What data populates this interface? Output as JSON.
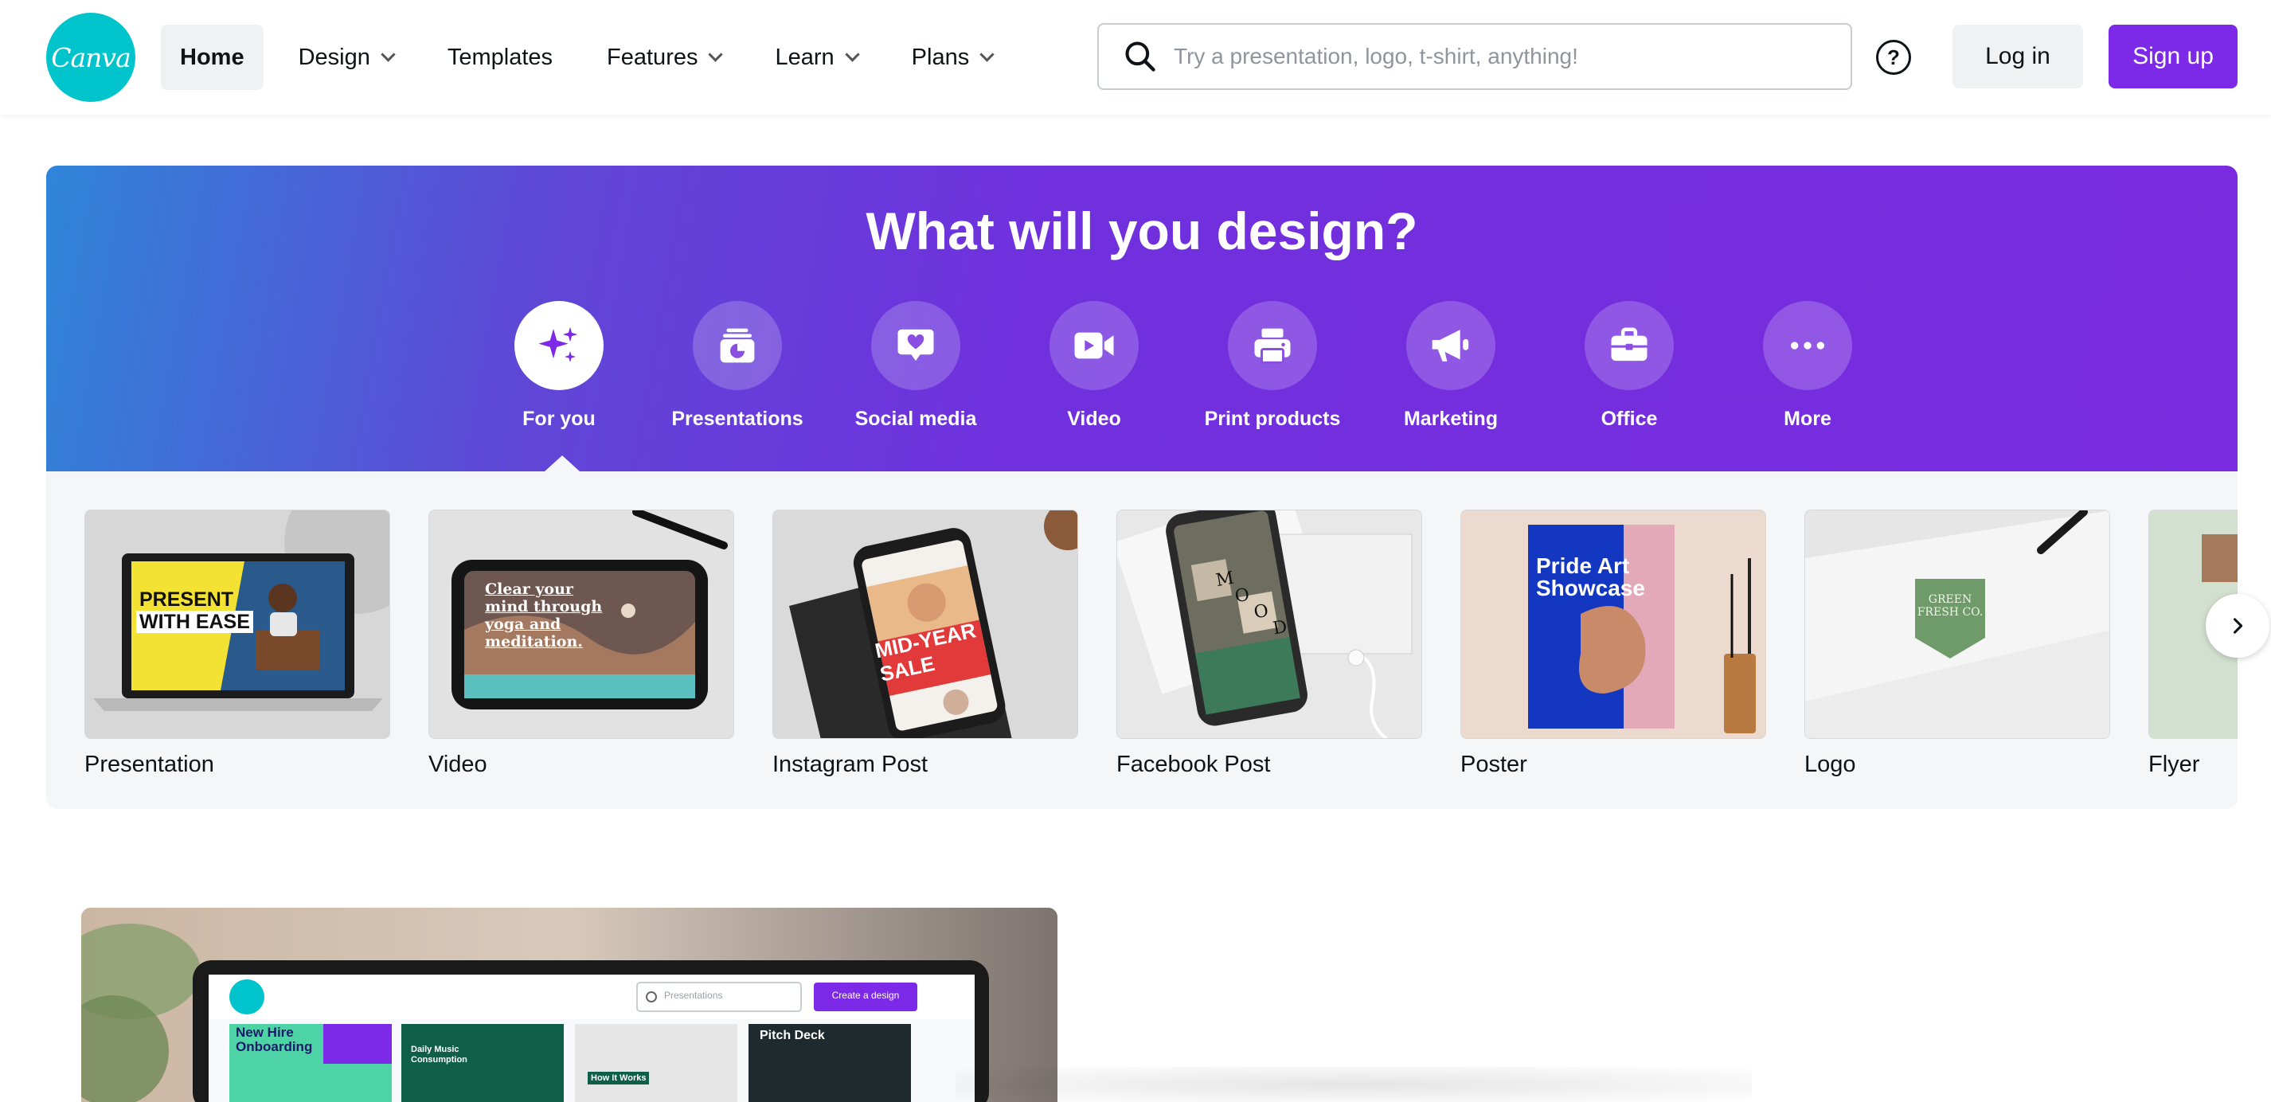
{
  "header": {
    "logo_text": "Canva",
    "nav": [
      {
        "label": "Home",
        "dropdown": false,
        "active": true
      },
      {
        "label": "Design",
        "dropdown": true
      },
      {
        "label": "Templates",
        "dropdown": false
      },
      {
        "label": "Features",
        "dropdown": true
      },
      {
        "label": "Learn",
        "dropdown": true
      },
      {
        "label": "Plans",
        "dropdown": true
      }
    ],
    "search_placeholder": "Try a presentation, logo, t-shirt, anything!",
    "help_label": "?",
    "login_label": "Log in",
    "signup_label": "Sign up"
  },
  "hero": {
    "title": "What will you design?",
    "categories": [
      {
        "label": "For you",
        "icon": "sparkle-icon",
        "active": true
      },
      {
        "label": "Presentations",
        "icon": "presentation-chart-icon"
      },
      {
        "label": "Social media",
        "icon": "heart-bubble-icon"
      },
      {
        "label": "Video",
        "icon": "video-camera-icon"
      },
      {
        "label": "Print products",
        "icon": "printer-icon"
      },
      {
        "label": "Marketing",
        "icon": "megaphone-icon"
      },
      {
        "label": "Office",
        "icon": "briefcase-icon"
      },
      {
        "label": "More",
        "icon": "more-dots-icon"
      }
    ]
  },
  "templates": [
    {
      "label": "Presentation",
      "thumb_text": [
        "PRESENT",
        "WITH EASE"
      ]
    },
    {
      "label": "Video",
      "thumb_text": [
        "Clear your",
        "mind through",
        "yoga and",
        "meditation."
      ]
    },
    {
      "label": "Instagram Post",
      "thumb_text": [
        "MID-YEAR",
        "SALE"
      ]
    },
    {
      "label": "Facebook Post",
      "thumb_text": [
        "M",
        "O",
        "O",
        "D"
      ]
    },
    {
      "label": "Poster",
      "thumb_text": [
        "Pride Art",
        "Showcase"
      ]
    },
    {
      "label": "Logo",
      "thumb_text": [
        "GREEN",
        "FRESH CO."
      ]
    },
    {
      "label": "Flyer",
      "thumb_text": []
    }
  ],
  "promo": {
    "search_placeholder": "Presentations",
    "create_label": "Create a design",
    "tiles": [
      "New Hire Onboarding",
      "Daily Music Consumption",
      "How It Works",
      "Pitch Deck"
    ]
  },
  "colors": {
    "brand_purple": "#7d2ae8",
    "logo_teal": "#00c4cc",
    "hero_gradient_start": "#2f85d9",
    "hero_gradient_end": "#7a2bdf"
  }
}
